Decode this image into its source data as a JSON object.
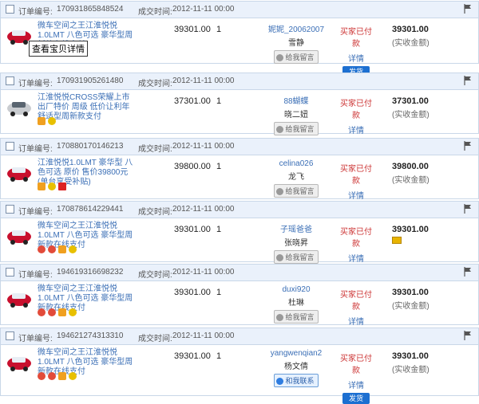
{
  "labels": {
    "order_no": "订单编号:",
    "deal_time": "成交时间:",
    "message": "给我留言",
    "contact": "和我联系",
    "details": "详情",
    "ship": "发货",
    "tooltip": "查看宝贝详情"
  },
  "orders": [
    {
      "order_no": "170931865848524",
      "time": "2012-11-11 00:00",
      "title": "微车空间之王江淮悦悦1.0LMT 八色可选 豪华型周新款在线支付",
      "price": "39301.00",
      "qty": "1",
      "buyer": "妮妮_20062007",
      "buyer_nick": "雪静",
      "status": "买家已付款",
      "total": "39301.00",
      "total_note": "(实收金额)",
      "chat": "给我留言"
    },
    {
      "order_no": "170931905261480",
      "time": "2012-11-11 00:00",
      "title": "江淮悦悦CROSS荣耀上市出厂特价 周级 低价让利年 舒适型周新款支付",
      "price": "37301.00",
      "qty": "1",
      "buyer": "88蝴蝶",
      "buyer_nick": "晓二妞",
      "status": "买家已付款",
      "total": "37301.00",
      "total_note": "(实收金额)",
      "chat": "给我留言"
    },
    {
      "order_no": "170880170146213",
      "time": "2012-11-11 00:00",
      "title": "江淮悦悦1.0LMT 豪华型 八色可选 原价 售价39800元 (单台享受补贴)",
      "price": "39800.00",
      "qty": "1",
      "buyer": "celina026",
      "buyer_nick": "龙飞",
      "status": "买家已付款",
      "total": "39800.00",
      "total_note": "(实收金额)",
      "chat": "给我留言"
    },
    {
      "order_no": "170878614229441",
      "time": "2012-11-11 00:00",
      "title": "微车空间之王江淮悦悦1.0LMT 八色可选 豪华型周新款在线支付",
      "price": "39301.00",
      "qty": "1",
      "buyer": "子瑶爸爸",
      "buyer_nick": "张晓昇",
      "status": "买家已付款",
      "total": "39301.00",
      "total_note": "",
      "chat": "给我留言"
    },
    {
      "order_no": "194619316698232",
      "time": "2012-11-11 00:00",
      "title": "微车空间之王江淮悦悦1.0LMT 八色可选 豪华型周新款在线支付",
      "price": "39301.00",
      "qty": "1",
      "buyer": "duxi920",
      "buyer_nick": "杜琳",
      "status": "买家已付款",
      "total": "39301.00",
      "total_note": "(实收金额)",
      "chat": "给我留言"
    },
    {
      "order_no": "194621274313310",
      "time": "2012-11-11 00:00",
      "title": "微车空间之王江淮悦悦1.0LMT 八色可选 豪华型周新款在线支付",
      "price": "39301.00",
      "qty": "1",
      "buyer": "yangwenqian2",
      "buyer_nick": "杨文倩",
      "status": "买家已付款",
      "total": "39301.00",
      "total_note": "(实收金额)",
      "chat": "和我联系"
    }
  ]
}
